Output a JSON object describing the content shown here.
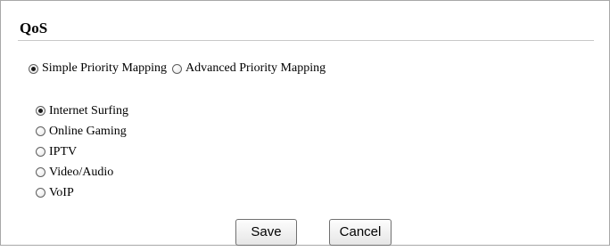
{
  "section": {
    "title": "QoS"
  },
  "mapping_mode": {
    "selected": "simple",
    "options": [
      {
        "id": "simple",
        "label": "Simple Priority Mapping"
      },
      {
        "id": "advanced",
        "label": "Advanced Priority Mapping"
      }
    ]
  },
  "priority_profiles": {
    "selected": "internet_surfing",
    "options": [
      {
        "id": "internet_surfing",
        "label": "Internet Surfing"
      },
      {
        "id": "online_gaming",
        "label": "Online Gaming"
      },
      {
        "id": "iptv",
        "label": "IPTV"
      },
      {
        "id": "video_audio",
        "label": "Video/Audio"
      },
      {
        "id": "voip",
        "label": "VoIP"
      }
    ]
  },
  "buttons": {
    "save_label": "Save",
    "cancel_label": "Cancel"
  }
}
